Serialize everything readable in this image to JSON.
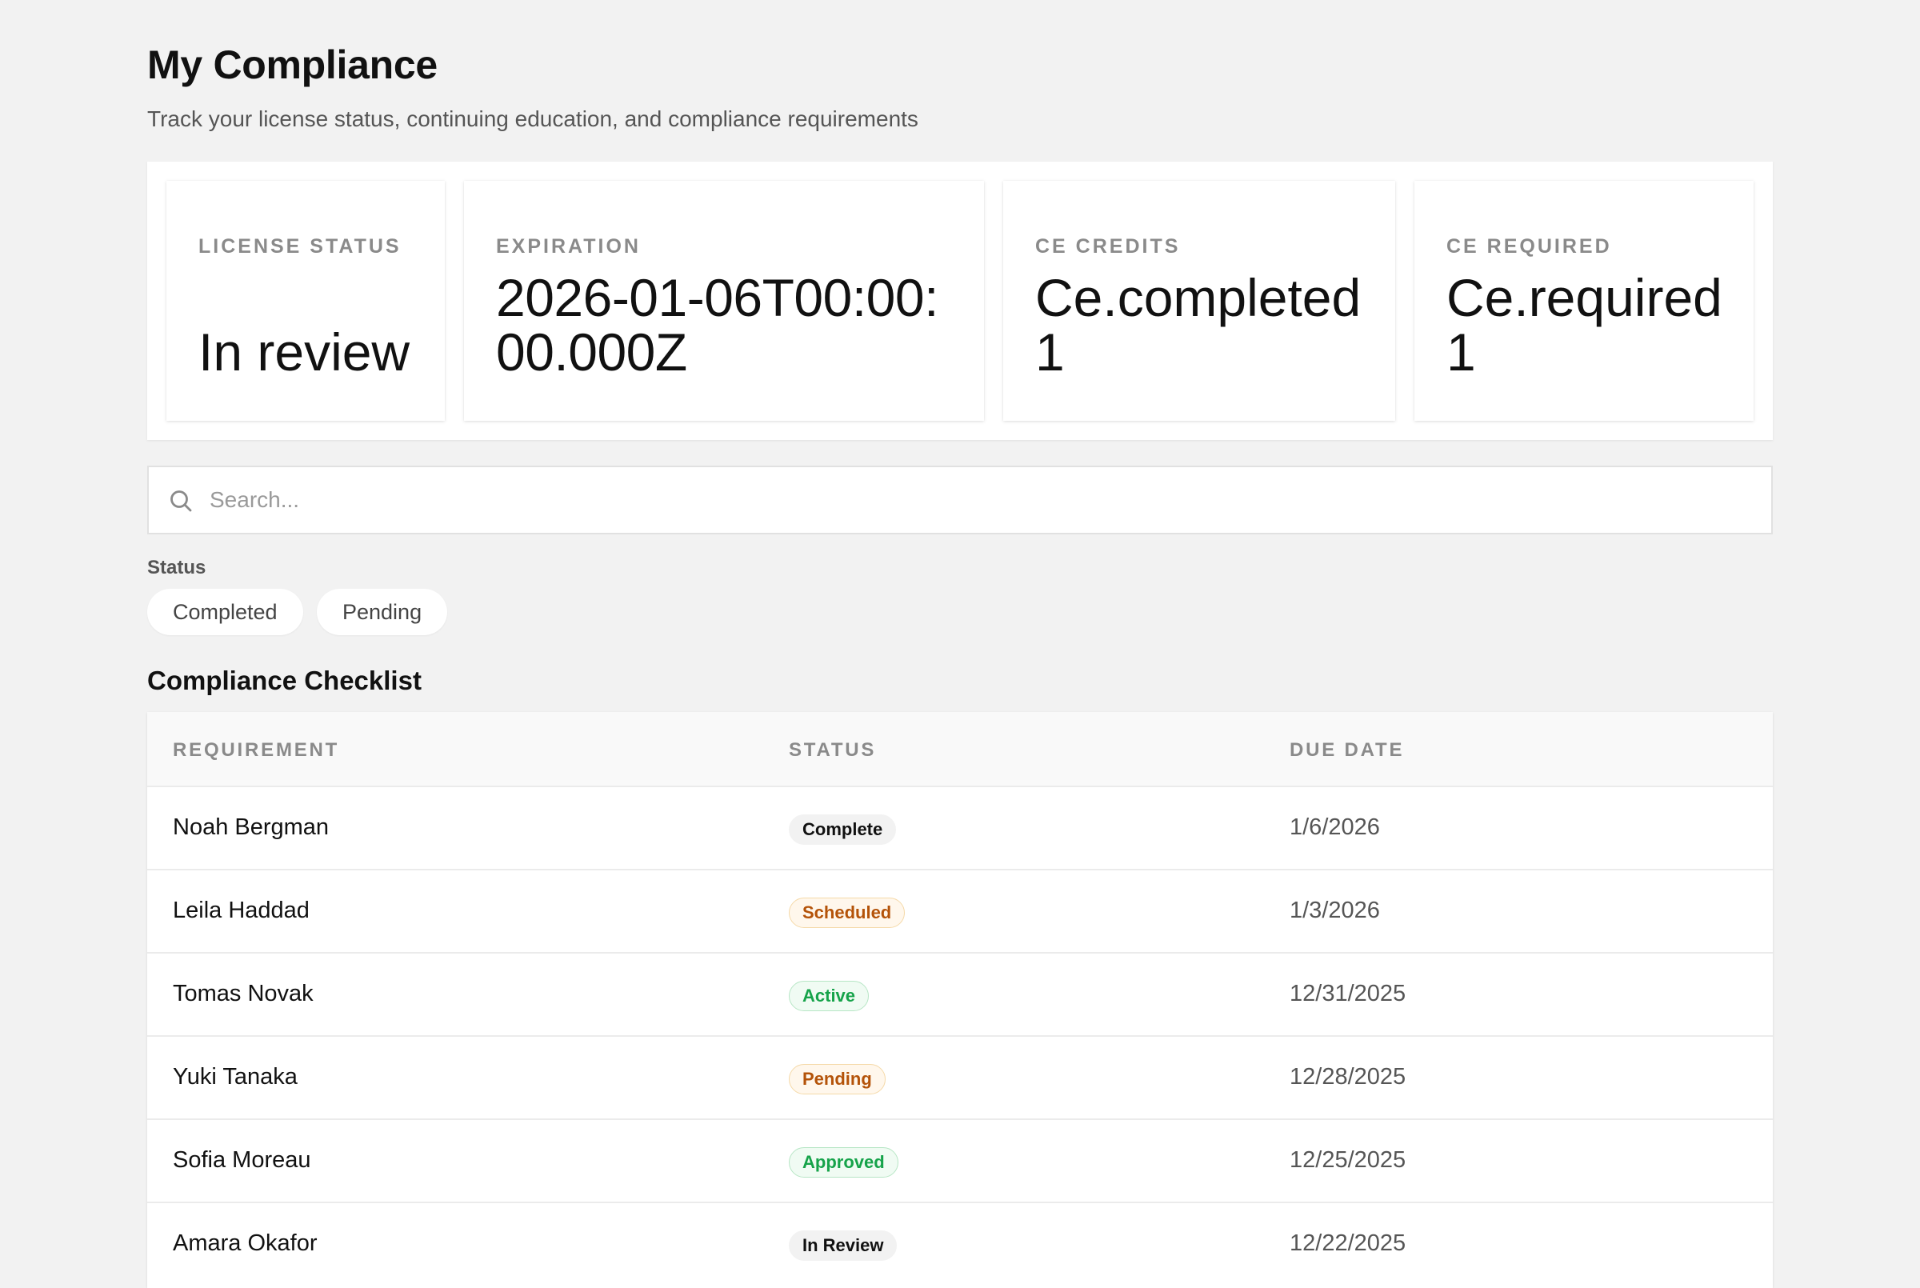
{
  "page": {
    "title": "My Compliance",
    "subtitle": "Track your license status, continuing education, and compliance requirements"
  },
  "stats": {
    "license_status": {
      "label": "LICENSE STATUS",
      "value": "In review"
    },
    "expiration": {
      "label": "EXPIRATION",
      "value": "2026-01-06T00:00:00.000Z"
    },
    "ce_credits": {
      "label": "CE CREDITS",
      "value": "Ce.completed 1"
    },
    "ce_required": {
      "label": "CE REQUIRED",
      "value": "Ce.required 1"
    }
  },
  "search": {
    "placeholder": "Search...",
    "icon": "search-icon"
  },
  "filters": {
    "label": "Status",
    "options": [
      "Completed",
      "Pending"
    ]
  },
  "checklist": {
    "title": "Compliance Checklist",
    "columns": [
      "REQUIREMENT",
      "STATUS",
      "DUE DATE"
    ],
    "rows": [
      {
        "requirement": "Noah Bergman",
        "status": "Complete",
        "due_date": "1/6/2026"
      },
      {
        "requirement": "Leila Haddad",
        "status": "Scheduled",
        "due_date": "1/3/2026"
      },
      {
        "requirement": "Tomas Novak",
        "status": "Active",
        "due_date": "12/31/2025"
      },
      {
        "requirement": "Yuki Tanaka",
        "status": "Pending",
        "due_date": "12/28/2025"
      },
      {
        "requirement": "Sofia Moreau",
        "status": "Approved",
        "due_date": "12/25/2025"
      },
      {
        "requirement": "Amara Okafor",
        "status": "In Review",
        "due_date": "12/22/2025"
      }
    ]
  },
  "colors": {
    "background": "#f2f2f2",
    "card": "#ffffff",
    "status_neutral": "#f2f2f2",
    "status_warning_text": "#b45309",
    "status_success_text": "#16a34a"
  }
}
